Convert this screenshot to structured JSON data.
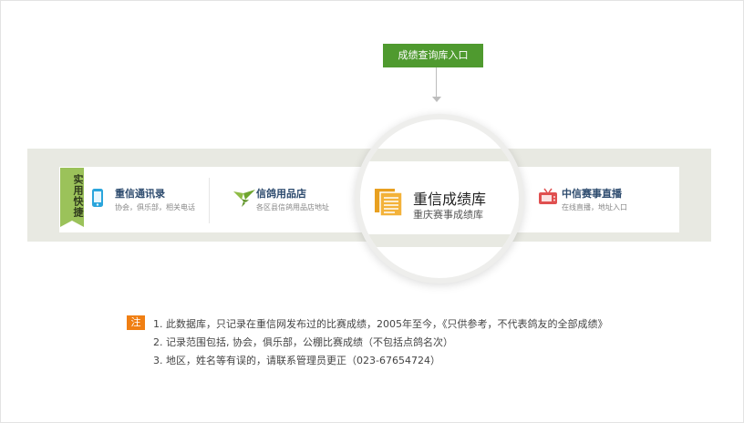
{
  "entry_button": "成绩查询库入口",
  "ribbon": "实用快捷",
  "items": [
    {
      "title": "重信通讯录",
      "sub": "协会，俱乐部，相关电话"
    },
    {
      "title": "信鸽用品店",
      "sub": "各区县信鸽用品店地址"
    },
    {
      "title": "中信赛事直播",
      "sub": "在线直播，地址入口"
    }
  ],
  "highlight": {
    "title": "重信成绩库",
    "sub": "重庆赛事成绩库"
  },
  "note": {
    "badge": "注",
    "lines": [
      "1. 此数据库，只记录在重信网发布过的比赛成绩，2005年至今，《只供参考，不代表鸽友的全部成绩》",
      "2. 记录范围包括, 协会，俱乐部，公棚比赛成绩（不包括点鸽名次）",
      "3. 地区，姓名等有误的，请联系管理员更正（023-67654724）"
    ]
  },
  "colors": {
    "accent_green": "#4f9a2f",
    "ribbon_green": "#9bc25a",
    "badge_orange": "#f07f13",
    "title_blue": "#2d4b6e"
  }
}
